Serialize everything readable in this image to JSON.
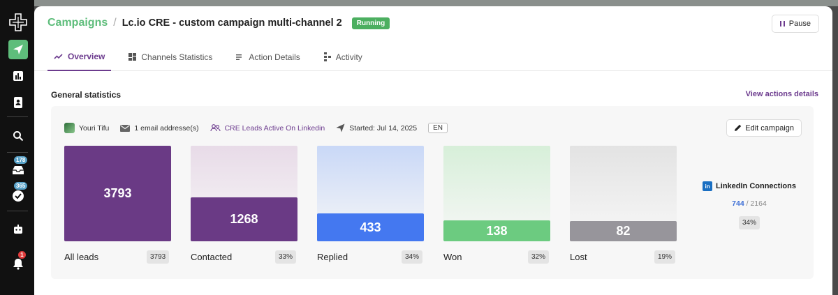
{
  "sidebar": {
    "inbox_badge": "178",
    "tasks_badge": "365",
    "notif_badge": "1"
  },
  "header": {
    "breadcrumb_root": "Campaigns",
    "breadcrumb_sep": "/",
    "campaign_title": "Lc.io CRE - custom campaign multi-channel 2",
    "status": "Running",
    "pause_label": "Pause"
  },
  "tabs": [
    {
      "label": "Overview",
      "icon": "trend-icon",
      "active": true
    },
    {
      "label": "Channels Statistics",
      "icon": "grid-icon",
      "active": false
    },
    {
      "label": "Action Details",
      "icon": "list-icon",
      "active": false
    },
    {
      "label": "Activity",
      "icon": "activity-icon",
      "active": false
    }
  ],
  "general": {
    "title": "General statistics",
    "view_link": "View actions details"
  },
  "meta": {
    "owner": "Youri Tifu",
    "emails": "1 email addresse(s)",
    "audience": "CRE Leads Active On Linkedin",
    "started": "Started: Jul 14, 2025",
    "lang": "EN",
    "edit_label": "Edit campaign"
  },
  "stats": [
    {
      "label": "All leads",
      "value": "3793",
      "badge": "3793",
      "fraction": 1.0,
      "color": "#6a3a85",
      "bg": "#ffffff"
    },
    {
      "label": "Contacted",
      "value": "1268",
      "badge": "33%",
      "fraction": 0.46,
      "color": "#6a3a85",
      "bg": "#e8dbe8"
    },
    {
      "label": "Replied",
      "value": "433",
      "badge": "34%",
      "fraction": 0.29,
      "color": "#4478f0",
      "bg": "#c9d8f7"
    },
    {
      "label": "Won",
      "value": "138",
      "badge": "32%",
      "fraction": 0.22,
      "color": "#6ccb80",
      "bg": "#d7efd9"
    },
    {
      "label": "Lost",
      "value": "82",
      "badge": "19%",
      "fraction": 0.21,
      "color": "#97959b",
      "bg": "#e3e3e3"
    }
  ],
  "linkedin": {
    "title": "LinkedIn Connections",
    "accepted": "744",
    "sep": "/",
    "total": "2164",
    "pct": "34%"
  }
}
